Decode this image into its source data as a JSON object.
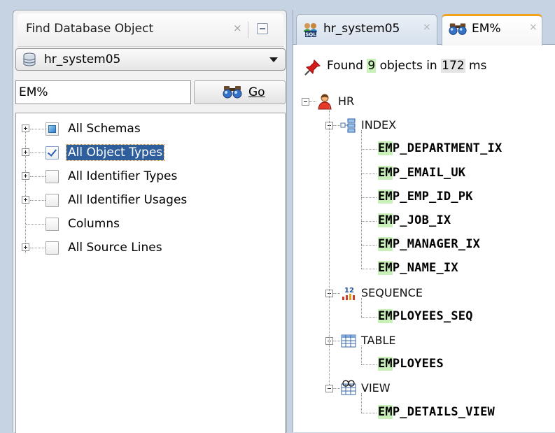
{
  "left_panel": {
    "title": "Find Database Object",
    "close_glyph": "×",
    "connection": "hr_system05",
    "search_value": "EM%",
    "go_label": "Go",
    "filters": [
      {
        "label": "All Schemas",
        "expandable": true,
        "state": "partial"
      },
      {
        "label": "All Object Types",
        "expandable": true,
        "state": "checked",
        "selected": true
      },
      {
        "label": "All Identifier Types",
        "expandable": true,
        "state": "unchecked"
      },
      {
        "label": "All Identifier Usages",
        "expandable": true,
        "state": "unchecked"
      },
      {
        "label": "Columns",
        "expandable": false,
        "state": "unchecked"
      },
      {
        "label": "All Source Lines",
        "expandable": true,
        "state": "unchecked"
      }
    ]
  },
  "right_panel": {
    "tabs": [
      {
        "label": "hr_system05",
        "icon": "sql-connection-icon",
        "active": false
      },
      {
        "label": "EM%",
        "icon": "binoculars-icon",
        "active": true
      }
    ],
    "tab_close_glyph": "×",
    "found": {
      "prefix": "Found",
      "count": "9",
      "middle": "objects in",
      "ms": "172",
      "suffix": "ms"
    },
    "tree": {
      "schema": "HR",
      "match_prefix": "EM",
      "categories": [
        {
          "name": "INDEX",
          "icon": "index-icon",
          "items": [
            "EMP_DEPARTMENT_IX",
            "EMP_EMAIL_UK",
            "EMP_EMP_ID_PK",
            "EMP_JOB_IX",
            "EMP_MANAGER_IX",
            "EMP_NAME_IX"
          ]
        },
        {
          "name": "SEQUENCE",
          "icon": "sequence-icon",
          "items": [
            "EMPLOYEES_SEQ"
          ]
        },
        {
          "name": "TABLE",
          "icon": "table-icon",
          "items": [
            "EMPLOYEES"
          ]
        },
        {
          "name": "VIEW",
          "icon": "view-icon",
          "items": [
            "EMP_DETAILS_VIEW"
          ]
        }
      ]
    }
  },
  "colors": {
    "background": "#c6d3e2",
    "selection": "#2f5e9c",
    "match_highlight": "#c8f0b8",
    "active_tab_accent": "#f0a21d"
  }
}
